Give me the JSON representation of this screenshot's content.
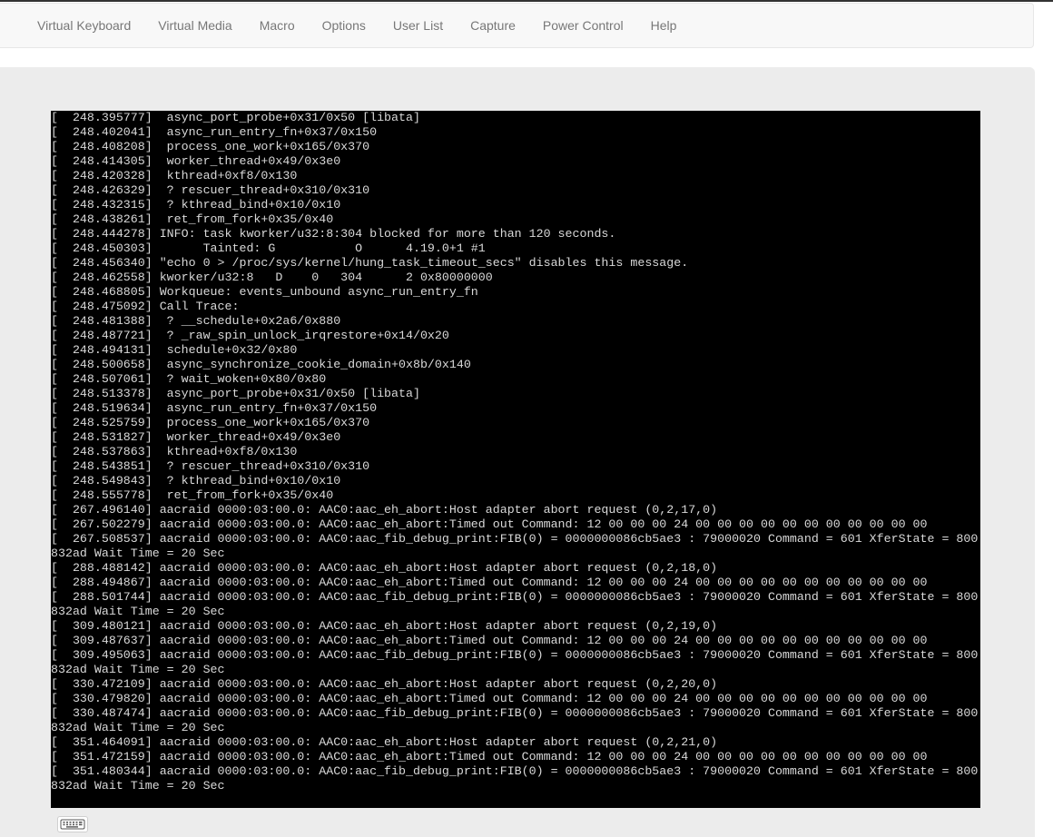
{
  "navbar": {
    "items": [
      {
        "label": "Virtual Keyboard",
        "name": "nav-virtual-keyboard"
      },
      {
        "label": "Virtual Media",
        "name": "nav-virtual-media"
      },
      {
        "label": "Macro",
        "name": "nav-macro"
      },
      {
        "label": "Options",
        "name": "nav-options"
      },
      {
        "label": "User List",
        "name": "nav-user-list"
      },
      {
        "label": "Capture",
        "name": "nav-capture"
      },
      {
        "label": "Power Control",
        "name": "nav-power-control"
      },
      {
        "label": "Help",
        "name": "nav-help"
      }
    ]
  },
  "console": {
    "lines": [
      "[  248.395777]  async_port_probe+0x31/0x50 [libata]",
      "[  248.402041]  async_run_entry_fn+0x37/0x150",
      "[  248.408208]  process_one_work+0x165/0x370",
      "[  248.414305]  worker_thread+0x49/0x3e0",
      "[  248.420328]  kthread+0xf8/0x130",
      "[  248.426329]  ? rescuer_thread+0x310/0x310",
      "[  248.432315]  ? kthread_bind+0x10/0x10",
      "[  248.438261]  ret_from_fork+0x35/0x40",
      "[  248.444278] INFO: task kworker/u32:8:304 blocked for more than 120 seconds.",
      "[  248.450303]       Tainted: G           O      4.19.0+1 #1",
      "[  248.456340] \"echo 0 > /proc/sys/kernel/hung_task_timeout_secs\" disables this message.",
      "[  248.462558] kworker/u32:8   D    0   304      2 0x80000000",
      "[  248.468805] Workqueue: events_unbound async_run_entry_fn",
      "[  248.475092] Call Trace:",
      "[  248.481388]  ? __schedule+0x2a6/0x880",
      "[  248.487721]  ? _raw_spin_unlock_irqrestore+0x14/0x20",
      "[  248.494131]  schedule+0x32/0x80",
      "[  248.500658]  async_synchronize_cookie_domain+0x8b/0x140",
      "[  248.507061]  ? wait_woken+0x80/0x80",
      "[  248.513378]  async_port_probe+0x31/0x50 [libata]",
      "[  248.519634]  async_run_entry_fn+0x37/0x150",
      "[  248.525759]  process_one_work+0x165/0x370",
      "[  248.531827]  worker_thread+0x49/0x3e0",
      "[  248.537863]  kthread+0xf8/0x130",
      "[  248.543851]  ? rescuer_thread+0x310/0x310",
      "[  248.549843]  ? kthread_bind+0x10/0x10",
      "[  248.555778]  ret_from_fork+0x35/0x40",
      "[  267.496140] aacraid 0000:03:00.0: AAC0:aac_eh_abort:Host adapter abort request (0,2,17,0)",
      "[  267.502279] aacraid 0000:03:00.0: AAC0:aac_eh_abort:Timed out Command: 12 00 00 00 24 00 00 00 00 00 00 00 00 00 00 00",
      "[  267.508537] aacraid 0000:03:00.0: AAC0:aac_fib_debug_print:FIB(0) = 0000000086cb5ae3 : 79000020 Command = 601 XferState = 800",
      "832ad Wait Time = 20 Sec",
      "[  288.488142] aacraid 0000:03:00.0: AAC0:aac_eh_abort:Host adapter abort request (0,2,18,0)",
      "[  288.494867] aacraid 0000:03:00.0: AAC0:aac_eh_abort:Timed out Command: 12 00 00 00 24 00 00 00 00 00 00 00 00 00 00 00",
      "[  288.501744] aacraid 0000:03:00.0: AAC0:aac_fib_debug_print:FIB(0) = 0000000086cb5ae3 : 79000020 Command = 601 XferState = 800",
      "832ad Wait Time = 20 Sec",
      "[  309.480121] aacraid 0000:03:00.0: AAC0:aac_eh_abort:Host adapter abort request (0,2,19,0)",
      "[  309.487637] aacraid 0000:03:00.0: AAC0:aac_eh_abort:Timed out Command: 12 00 00 00 24 00 00 00 00 00 00 00 00 00 00 00",
      "[  309.495063] aacraid 0000:03:00.0: AAC0:aac_fib_debug_print:FIB(0) = 0000000086cb5ae3 : 79000020 Command = 601 XferState = 800",
      "832ad Wait Time = 20 Sec",
      "[  330.472109] aacraid 0000:03:00.0: AAC0:aac_eh_abort:Host adapter abort request (0,2,20,0)",
      "[  330.479820] aacraid 0000:03:00.0: AAC0:aac_eh_abort:Timed out Command: 12 00 00 00 24 00 00 00 00 00 00 00 00 00 00 00",
      "[  330.487474] aacraid 0000:03:00.0: AAC0:aac_fib_debug_print:FIB(0) = 0000000086cb5ae3 : 79000020 Command = 601 XferState = 800",
      "832ad Wait Time = 20 Sec",
      "[  351.464091] aacraid 0000:03:00.0: AAC0:aac_eh_abort:Host adapter abort request (0,2,21,0)",
      "[  351.472159] aacraid 0000:03:00.0: AAC0:aac_eh_abort:Timed out Command: 12 00 00 00 24 00 00 00 00 00 00 00 00 00 00 00",
      "[  351.480344] aacraid 0000:03:00.0: AAC0:aac_fib_debug_print:FIB(0) = 0000000086cb5ae3 : 79000020 Command = 601 XferState = 800",
      "832ad Wait Time = 20 Sec"
    ]
  },
  "footer": {
    "keyboard_button_icon": "keyboard-icon"
  }
}
